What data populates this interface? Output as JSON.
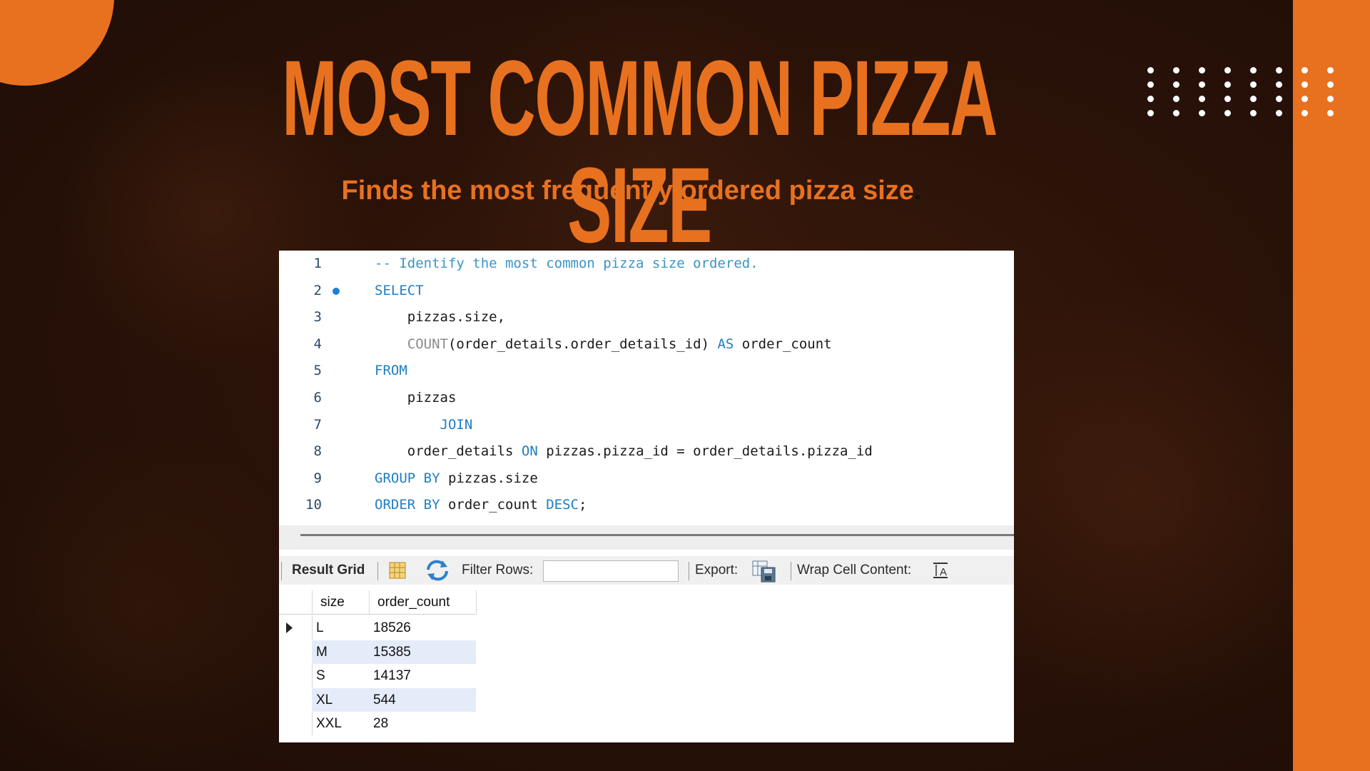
{
  "slide": {
    "title": "MOST COMMON PIZZA SIZE",
    "subtitle": "Finds the most frequently ordered pizza size",
    "subtitle_period": ".",
    "accent_color": "#e8711f"
  },
  "editor": {
    "lines": [
      {
        "n": "1",
        "parts": [
          {
            "t": "-- Identify the most common pizza size ordered.",
            "c": "cm"
          }
        ]
      },
      {
        "n": "2",
        "breakpoint": true,
        "parts": [
          {
            "t": "SELECT",
            "c": "kw"
          }
        ]
      },
      {
        "n": "3",
        "parts": [
          {
            "t": "    pizzas.size,",
            "c": ""
          }
        ]
      },
      {
        "n": "4",
        "parts": [
          {
            "t": "    ",
            "c": ""
          },
          {
            "t": "COUNT",
            "c": "fn"
          },
          {
            "t": "(order_details.order_details_id) ",
            "c": ""
          },
          {
            "t": "AS",
            "c": "kw"
          },
          {
            "t": " order_count",
            "c": ""
          }
        ]
      },
      {
        "n": "5",
        "parts": [
          {
            "t": "FROM",
            "c": "kw"
          }
        ]
      },
      {
        "n": "6",
        "parts": [
          {
            "t": "    pizzas",
            "c": ""
          }
        ]
      },
      {
        "n": "7",
        "parts": [
          {
            "t": "        ",
            "c": ""
          },
          {
            "t": "JOIN",
            "c": "kw"
          }
        ]
      },
      {
        "n": "8",
        "parts": [
          {
            "t": "    order_details ",
            "c": ""
          },
          {
            "t": "ON",
            "c": "kw"
          },
          {
            "t": " pizzas.pizza_id = order_details.pizza_id",
            "c": ""
          }
        ]
      },
      {
        "n": "9",
        "parts": [
          {
            "t": "GROUP BY",
            "c": "kw"
          },
          {
            "t": " pizzas.size",
            "c": ""
          }
        ]
      },
      {
        "n": "10",
        "parts": [
          {
            "t": "ORDER BY",
            "c": "kw"
          },
          {
            "t": " order_count ",
            "c": ""
          },
          {
            "t": "DESC",
            "c": "kw"
          },
          {
            "t": ";",
            "c": ""
          }
        ]
      }
    ]
  },
  "toolbar": {
    "result_grid_label": "Result Grid",
    "filter_rows_label": "Filter Rows:",
    "filter_rows_value": "",
    "export_label": "Export:",
    "wrap_label": "Wrap Cell Content:"
  },
  "result": {
    "columns": [
      "size",
      "order_count"
    ],
    "rows": [
      [
        "L",
        "18526"
      ],
      [
        "M",
        "15385"
      ],
      [
        "S",
        "14137"
      ],
      [
        "XL",
        "544"
      ],
      [
        "XXL",
        "28"
      ]
    ]
  }
}
